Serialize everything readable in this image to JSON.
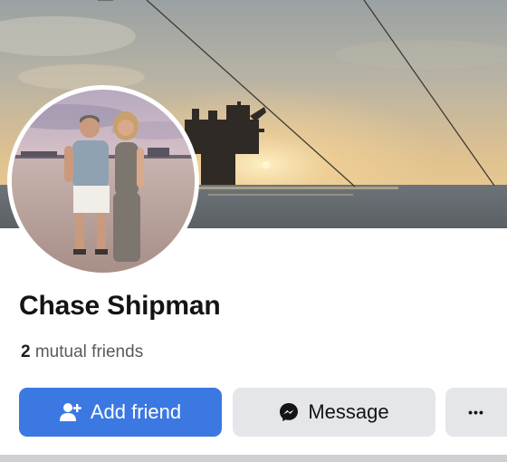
{
  "profile": {
    "name": "Chase Shipman",
    "mutual_count": "2",
    "mutual_label": "mutual friends"
  },
  "actions": {
    "add_friend_label": "Add friend",
    "message_label": "Message",
    "more_label": "•••"
  },
  "icons": {
    "add_friend": "add-person-icon",
    "message": "messenger-icon",
    "more": "more-dots-icon"
  },
  "colors": {
    "primary_button": "#3b78e2",
    "secondary_button": "#e5e6ea",
    "text_primary": "#141414",
    "text_secondary": "#5a5a5a"
  }
}
